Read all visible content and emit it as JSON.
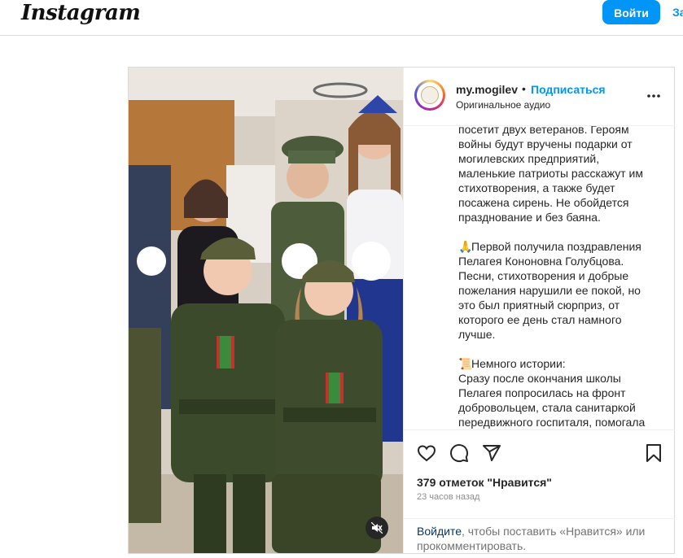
{
  "topbar": {
    "logo": "Instagram",
    "login_label": "Войти",
    "signup_label": "За"
  },
  "post": {
    "username": "my.mogilev",
    "separator": "•",
    "follow_label": "Подписаться",
    "audio": "Оригинальное аудио",
    "caption": {
      "p1": "посетит двух ветеранов. Героям войны будут вручены подарки от могилевских предприятий, маленькие патриоты расскажут им стихотворения, а также будет посажена сирень. Не обойдется празднование и без баяна.",
      "p2_emoji": "🙏",
      "p2": "Первой получила поздравления Пелагея Кононовна Голубцова. Песни, стихотворения и добрые пожелания нарушили ее покой, но это был приятный сюрприз, от которого ее день стал намного лучше.",
      "p3_emoji": "📜",
      "p3_head": "Немного истории:",
      "p3": "Сразу после окончания школы Пелагея попросилась на фронт добровольцем, стала санитаркой передвижного госпиталя, помогала"
    },
    "likes": "379 отметок \"Нравится\"",
    "time": "23 часов назад",
    "login_prompt": {
      "link": "Войдите",
      "rest": ", чтобы поставить «Нравится» или прокомментировать."
    }
  },
  "icons": {
    "like": "heart-icon",
    "comment": "comment-icon",
    "share": "share-icon",
    "save": "bookmark-icon",
    "more": "more-icon",
    "mute": "speaker-muted-icon"
  },
  "colors": {
    "accent": "#0095f6",
    "text": "#262626",
    "secondary": "#8e8e8e",
    "border": "#dbdbdb"
  }
}
